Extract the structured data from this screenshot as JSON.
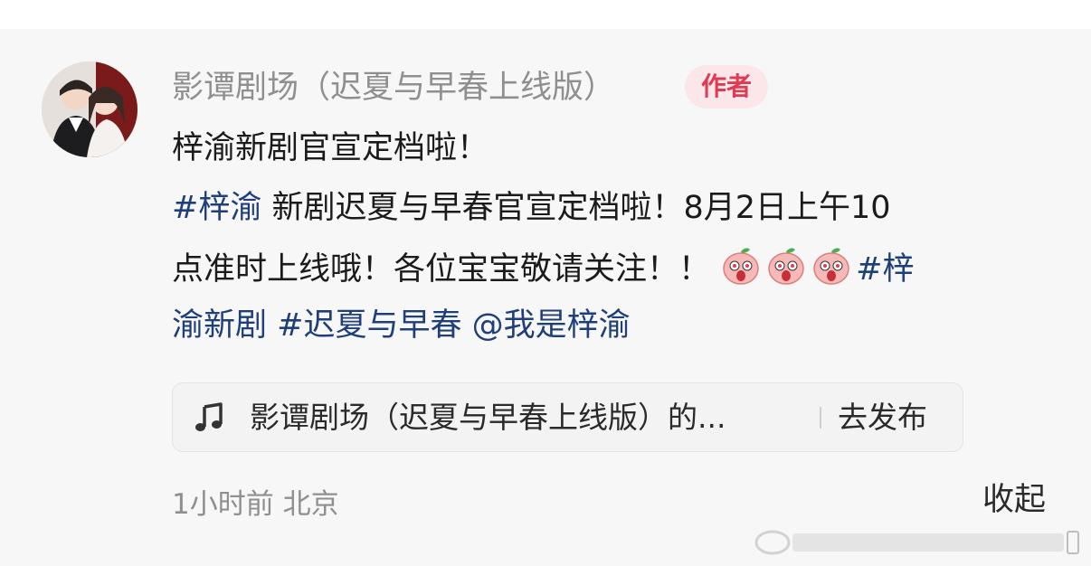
{
  "post": {
    "author_name": "影谭剧场（迟夏与早春上线版）",
    "author_badge": "作者",
    "headline": "梓渝新剧官宣定档啦！",
    "line1_tag": "#梓渝",
    "line1_text": " 新剧迟夏与早春官宣定档啦！8月2日上午10",
    "line2_text": "点准时上线哦！各位宝宝敬请关注！！",
    "line2_tag": "#梓",
    "line3_tag_tail": "渝新剧",
    "line3_tag2": "#迟夏与早春",
    "line3_mention": "@我是梓渝",
    "emoji_icons": [
      "peach-face-emoji",
      "peach-face-emoji",
      "peach-face-emoji"
    ]
  },
  "music_card": {
    "icon": "music-note-icon",
    "title": "影谭剧场（迟夏与早春上线版）的...",
    "action": "去发布"
  },
  "footer": {
    "time_location": "1小时前 北京",
    "collapse": "收起"
  },
  "colors": {
    "tag_blue": "#1f3f7a",
    "badge_red": "#e23a51",
    "badge_bg": "#fbe7ea",
    "muted_gray": "#8f8f8f"
  }
}
